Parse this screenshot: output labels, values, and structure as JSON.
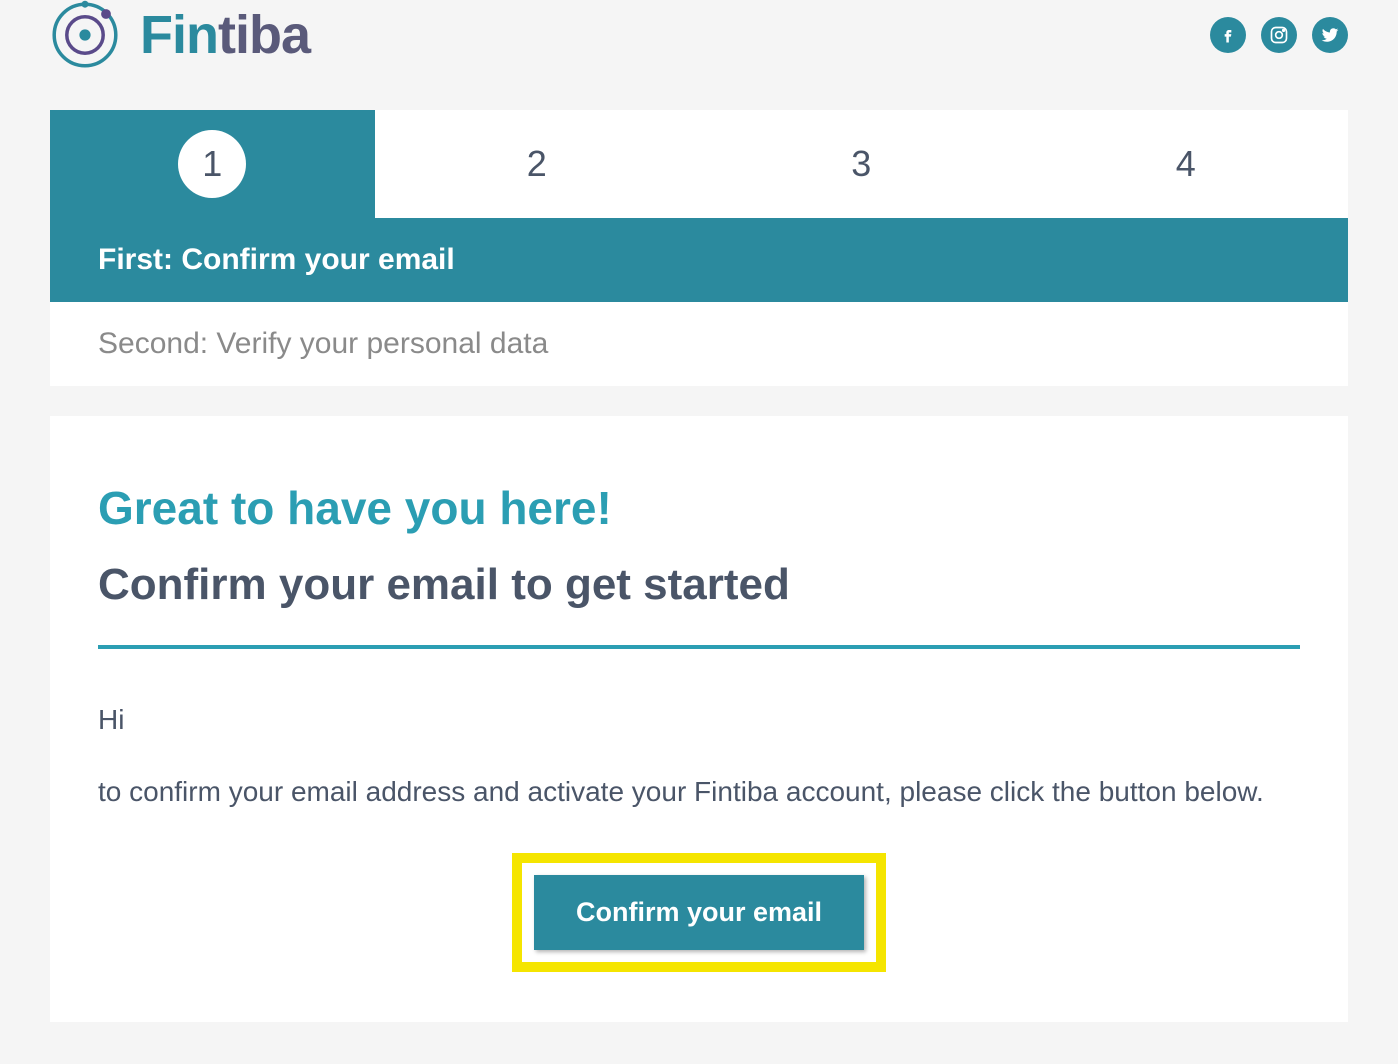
{
  "header": {
    "brand_name": "Fintiba"
  },
  "steps": {
    "items": [
      {
        "number": "1",
        "active": true
      },
      {
        "number": "2",
        "active": false
      },
      {
        "number": "3",
        "active": false
      },
      {
        "number": "4",
        "active": false
      }
    ],
    "active_title": "First: Confirm your email",
    "next_title": "Second: Verify your personal data"
  },
  "content": {
    "headline_teal": "Great to have you here!",
    "headline_dark": "Confirm your email to get started",
    "greeting": "Hi",
    "body": "to confirm your email address and activate your Fintiba account, please click the button below.",
    "button_label": "Confirm your email"
  }
}
